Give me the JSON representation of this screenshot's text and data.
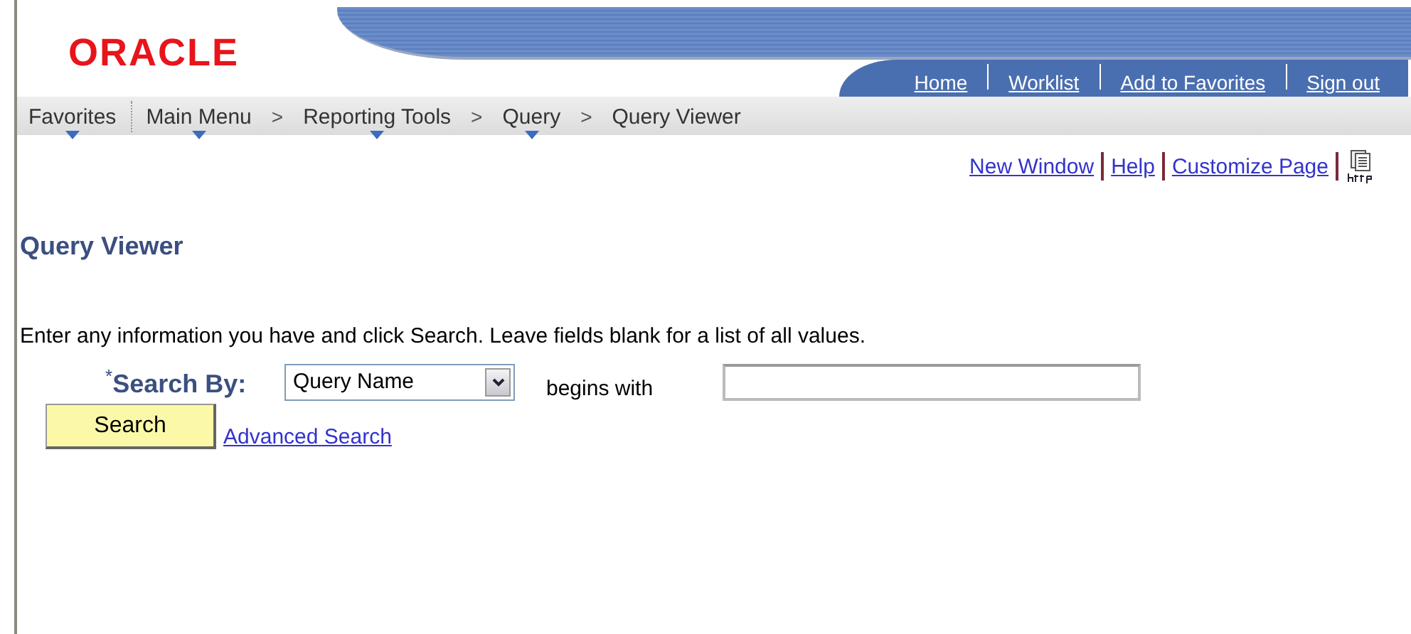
{
  "logo": {
    "text": "ORACLE"
  },
  "header_links": [
    "Home",
    "Worklist",
    "Add to Favorites",
    "Sign out"
  ],
  "nav": {
    "favorites": {
      "label": "Favorites",
      "has_menu": true
    },
    "separator": ">",
    "items": [
      {
        "label": "Main Menu",
        "has_menu": true
      },
      {
        "label": "Reporting Tools",
        "has_menu": true
      },
      {
        "label": "Query",
        "has_menu": true
      },
      {
        "label": "Query Viewer",
        "has_menu": false
      }
    ]
  },
  "page_links": [
    "New Window",
    "Help",
    "Customize Page"
  ],
  "title": "Query Viewer",
  "instructions": "Enter any information you have and click Search. Leave fields blank for a list of all values.",
  "search_by": {
    "required_mark": "*",
    "label": "Search By:",
    "value": "Query Name",
    "operator": "begins with"
  },
  "search_button": "Search",
  "advanced_search": "Advanced Search"
}
